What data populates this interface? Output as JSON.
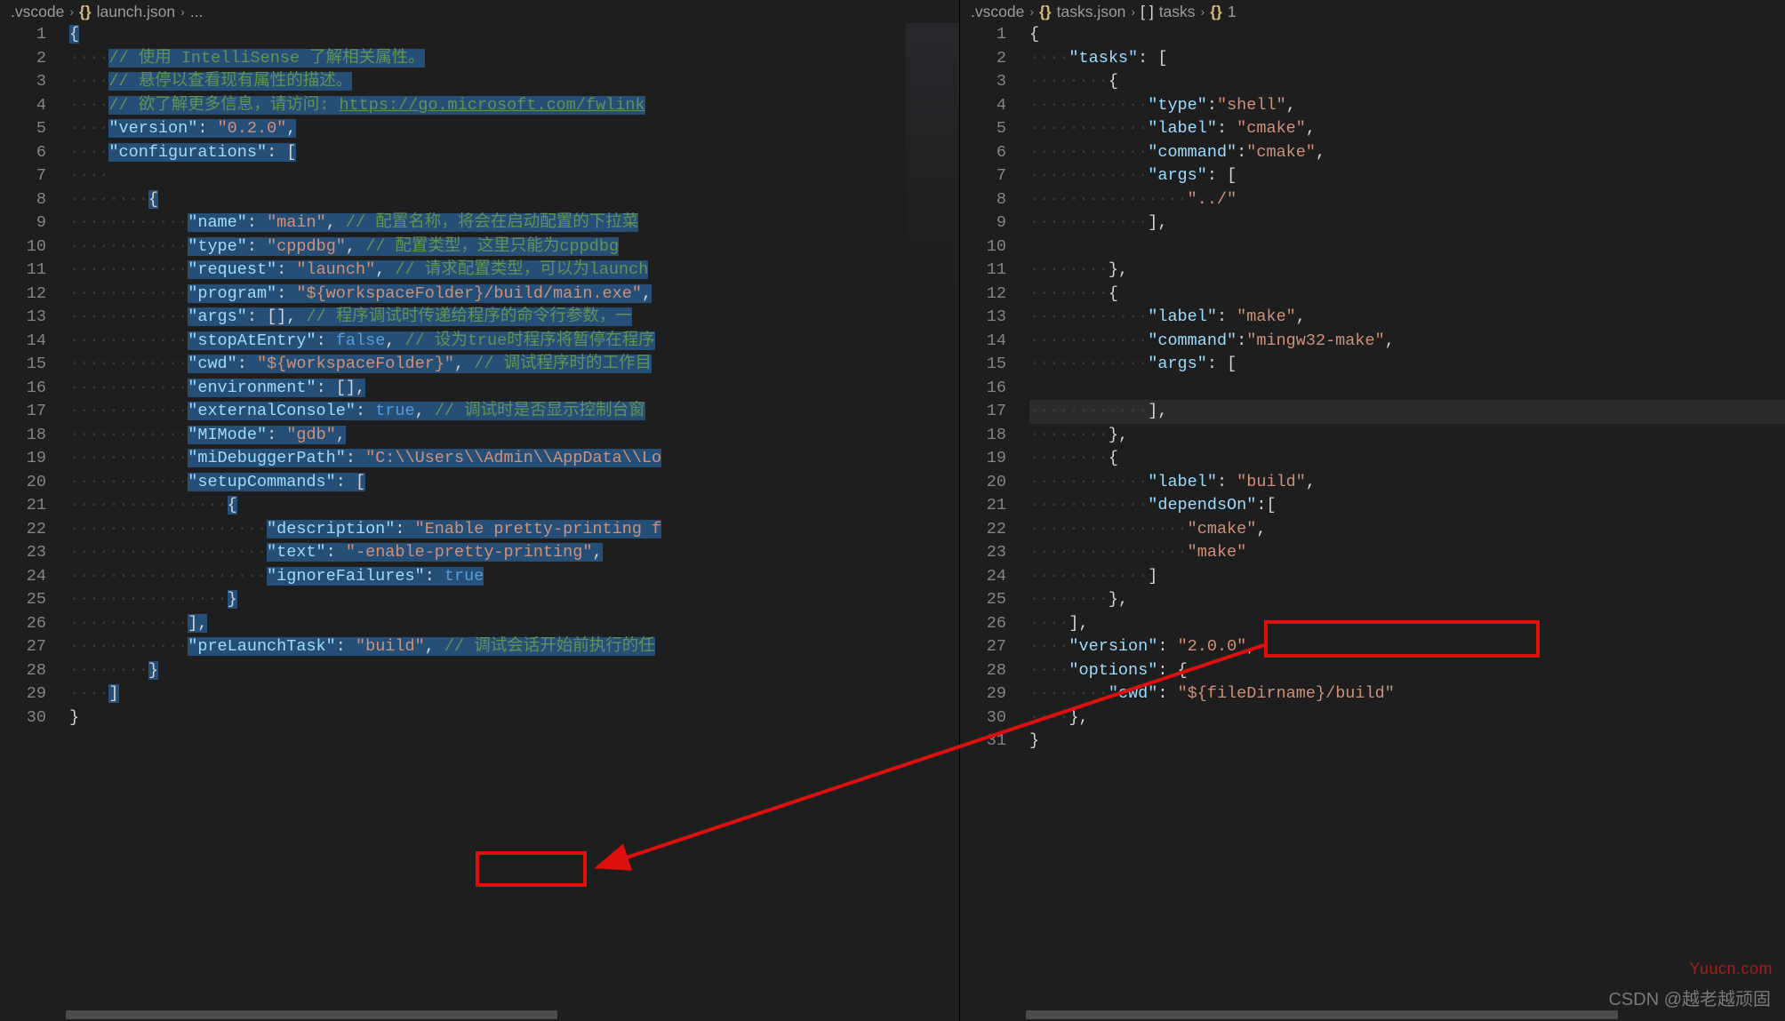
{
  "left": {
    "breadcrumb": {
      "folder": ".vscode",
      "file": "launch.json",
      "more": "..."
    },
    "lines": [
      {
        "n": 1,
        "indent": 0,
        "t": [
          [
            "b",
            "{"
          ]
        ]
      },
      {
        "n": 2,
        "indent": 1,
        "t": [
          [
            "c",
            "// 使用 IntelliSense 了解相关属性。"
          ]
        ]
      },
      {
        "n": 3,
        "indent": 1,
        "t": [
          [
            "c",
            "// 悬停以查看现有属性的描述。"
          ]
        ]
      },
      {
        "n": 4,
        "indent": 1,
        "t": [
          [
            "c",
            "// 欲了解更多信息，请访问: "
          ],
          [
            "link",
            "https://go.microsoft.com/fwlink"
          ]
        ]
      },
      {
        "n": 5,
        "indent": 1,
        "t": [
          [
            "k",
            "\"version\""
          ],
          [
            "p",
            ": "
          ],
          [
            "s",
            "\"0.2.0\""
          ],
          [
            "p",
            ","
          ]
        ]
      },
      {
        "n": 6,
        "indent": 1,
        "t": [
          [
            "k",
            "\"configurations\""
          ],
          [
            "p",
            ": "
          ],
          [
            "b",
            "["
          ]
        ]
      },
      {
        "n": 7,
        "indent": 1,
        "t": []
      },
      {
        "n": 8,
        "indent": 2,
        "t": [
          [
            "b",
            "{"
          ]
        ]
      },
      {
        "n": 9,
        "indent": 3,
        "t": [
          [
            "k",
            "\"name\""
          ],
          [
            "p",
            ": "
          ],
          [
            "s",
            "\"main\""
          ],
          [
            "p",
            ","
          ],
          [
            "c",
            " // 配置名称，将会在启动配置的下拉菜"
          ]
        ]
      },
      {
        "n": 10,
        "indent": 3,
        "t": [
          [
            "k",
            "\"type\""
          ],
          [
            "p",
            ": "
          ],
          [
            "s",
            "\"cppdbg\""
          ],
          [
            "p",
            ", "
          ],
          [
            "c",
            "// 配置类型，这里只能为cppdbg"
          ]
        ]
      },
      {
        "n": 11,
        "indent": 3,
        "t": [
          [
            "k",
            "\"request\""
          ],
          [
            "p",
            ": "
          ],
          [
            "s",
            "\"launch\""
          ],
          [
            "p",
            ", "
          ],
          [
            "c",
            "// 请求配置类型，可以为launch"
          ]
        ]
      },
      {
        "n": 12,
        "indent": 3,
        "t": [
          [
            "k",
            "\"program\""
          ],
          [
            "p",
            ": "
          ],
          [
            "s",
            "\"${workspaceFolder}/build/main.exe\""
          ],
          [
            "p",
            ","
          ]
        ]
      },
      {
        "n": 13,
        "indent": 3,
        "t": [
          [
            "k",
            "\"args\""
          ],
          [
            "p",
            ": "
          ],
          [
            "b",
            "[]"
          ],
          [
            "p",
            ", "
          ],
          [
            "c",
            "// 程序调试时传递给程序的命令行参数，一"
          ]
        ]
      },
      {
        "n": 14,
        "indent": 3,
        "t": [
          [
            "k",
            "\"stopAtEntry\""
          ],
          [
            "p",
            ": "
          ],
          [
            "bool",
            "false"
          ],
          [
            "p",
            ", "
          ],
          [
            "c",
            "// 设为true时程序将暂停在程序"
          ]
        ]
      },
      {
        "n": 15,
        "indent": 3,
        "t": [
          [
            "k",
            "\"cwd\""
          ],
          [
            "p",
            ": "
          ],
          [
            "s",
            "\"${workspaceFolder}\""
          ],
          [
            "p",
            ", "
          ],
          [
            "c",
            "// 调试程序时的工作目"
          ]
        ]
      },
      {
        "n": 16,
        "indent": 3,
        "t": [
          [
            "k",
            "\"environment\""
          ],
          [
            "p",
            ": "
          ],
          [
            "b",
            "[]"
          ],
          [
            "p",
            ","
          ]
        ]
      },
      {
        "n": 17,
        "indent": 3,
        "t": [
          [
            "k",
            "\"externalConsole\""
          ],
          [
            "p",
            ": "
          ],
          [
            "bool",
            "true"
          ],
          [
            "p",
            ", "
          ],
          [
            "c",
            "// 调试时是否显示控制台窗"
          ]
        ]
      },
      {
        "n": 18,
        "indent": 3,
        "t": [
          [
            "k",
            "\"MIMode\""
          ],
          [
            "p",
            ": "
          ],
          [
            "s",
            "\"gdb\""
          ],
          [
            "p",
            ","
          ]
        ]
      },
      {
        "n": 19,
        "indent": 3,
        "t": [
          [
            "k",
            "\"miDebuggerPath\""
          ],
          [
            "p",
            ": "
          ],
          [
            "s",
            "\"C:\\\\Users\\\\Admin\\\\AppData\\\\Lo"
          ]
        ]
      },
      {
        "n": 20,
        "indent": 3,
        "t": [
          [
            "k",
            "\"setupCommands\""
          ],
          [
            "p",
            ": "
          ],
          [
            "b",
            "["
          ]
        ]
      },
      {
        "n": 21,
        "indent": 4,
        "t": [
          [
            "b",
            "{"
          ]
        ]
      },
      {
        "n": 22,
        "indent": 5,
        "t": [
          [
            "k",
            "\"description\""
          ],
          [
            "p",
            ": "
          ],
          [
            "s",
            "\"Enable pretty-printing f"
          ]
        ]
      },
      {
        "n": 23,
        "indent": 5,
        "t": [
          [
            "k",
            "\"text\""
          ],
          [
            "p",
            ": "
          ],
          [
            "s",
            "\"-enable-pretty-printing\""
          ],
          [
            "p",
            ","
          ]
        ]
      },
      {
        "n": 24,
        "indent": 5,
        "t": [
          [
            "k",
            "\"ignoreFailures\""
          ],
          [
            "p",
            ": "
          ],
          [
            "bool",
            "true"
          ]
        ]
      },
      {
        "n": 25,
        "indent": 4,
        "t": [
          [
            "b",
            "}"
          ]
        ]
      },
      {
        "n": 26,
        "indent": 3,
        "t": [
          [
            "b",
            "]"
          ],
          [
            "p",
            ","
          ]
        ]
      },
      {
        "n": 27,
        "indent": 3,
        "t": [
          [
            "k",
            "\"preLaunchTask\""
          ],
          [
            "p",
            ": "
          ],
          [
            "s",
            "\"build\""
          ],
          [
            "p",
            ", "
          ],
          [
            "c",
            "// 调试会话开始前执行的任"
          ]
        ]
      },
      {
        "n": 28,
        "indent": 2,
        "t": [
          [
            "b",
            "}"
          ]
        ]
      },
      {
        "n": 29,
        "indent": 1,
        "t": [
          [
            "b",
            "]"
          ]
        ]
      },
      {
        "n": 30,
        "indent": 0,
        "t": [
          [
            "b",
            "}"
          ]
        ]
      }
    ]
  },
  "right": {
    "breadcrumb": {
      "folder": ".vscode",
      "file": "tasks.json",
      "array": "tasks",
      "obj": "1"
    },
    "lines": [
      {
        "n": 1,
        "indent": 0,
        "t": [
          [
            "b",
            "{"
          ]
        ]
      },
      {
        "n": 2,
        "indent": 1,
        "t": [
          [
            "k",
            "\"tasks\""
          ],
          [
            "p",
            ": "
          ],
          [
            "b",
            "["
          ]
        ]
      },
      {
        "n": 3,
        "indent": 2,
        "t": [
          [
            "b",
            "{"
          ]
        ]
      },
      {
        "n": 4,
        "indent": 3,
        "t": [
          [
            "k",
            "\"type\""
          ],
          [
            "p",
            ":"
          ],
          [
            "s",
            "\"shell\""
          ],
          [
            "p",
            ","
          ]
        ]
      },
      {
        "n": 5,
        "indent": 3,
        "t": [
          [
            "k",
            "\"label\""
          ],
          [
            "p",
            ": "
          ],
          [
            "s",
            "\"cmake\""
          ],
          [
            "p",
            ","
          ]
        ]
      },
      {
        "n": 6,
        "indent": 3,
        "t": [
          [
            "k",
            "\"command\""
          ],
          [
            "p",
            ":"
          ],
          [
            "s",
            "\"cmake\""
          ],
          [
            "p",
            ","
          ]
        ]
      },
      {
        "n": 7,
        "indent": 3,
        "t": [
          [
            "k",
            "\"args\""
          ],
          [
            "p",
            ": "
          ],
          [
            "b",
            "["
          ]
        ]
      },
      {
        "n": 8,
        "indent": 4,
        "t": [
          [
            "s",
            "\"../\""
          ]
        ]
      },
      {
        "n": 9,
        "indent": 3,
        "t": [
          [
            "b",
            "]"
          ],
          [
            "p",
            ","
          ]
        ]
      },
      {
        "n": 10,
        "indent": 0,
        "t": []
      },
      {
        "n": 11,
        "indent": 2,
        "t": [
          [
            "b",
            "}"
          ],
          [
            "p",
            ","
          ]
        ]
      },
      {
        "n": 12,
        "indent": 2,
        "t": [
          [
            "b",
            "{"
          ]
        ]
      },
      {
        "n": 13,
        "indent": 3,
        "t": [
          [
            "k",
            "\"label\""
          ],
          [
            "p",
            ": "
          ],
          [
            "s",
            "\"make\""
          ],
          [
            "p",
            ","
          ]
        ]
      },
      {
        "n": 14,
        "indent": 3,
        "t": [
          [
            "k",
            "\"command\""
          ],
          [
            "p",
            ":"
          ],
          [
            "s",
            "\"mingw32-make\""
          ],
          [
            "p",
            ","
          ]
        ]
      },
      {
        "n": 15,
        "indent": 3,
        "t": [
          [
            "k",
            "\"args\""
          ],
          [
            "p",
            ": "
          ],
          [
            "b",
            "["
          ]
        ]
      },
      {
        "n": 16,
        "indent": 0,
        "t": []
      },
      {
        "n": 17,
        "indent": 3,
        "t": [
          [
            "b",
            "]"
          ],
          [
            "p",
            ","
          ]
        ]
      },
      {
        "n": 18,
        "indent": 2,
        "t": [
          [
            "b",
            "}"
          ],
          [
            "p",
            ","
          ]
        ]
      },
      {
        "n": 19,
        "indent": 2,
        "t": [
          [
            "b",
            "{"
          ]
        ]
      },
      {
        "n": 20,
        "indent": 3,
        "t": [
          [
            "k",
            "\"label\""
          ],
          [
            "p",
            ": "
          ],
          [
            "s",
            "\"build\""
          ],
          [
            "p",
            ","
          ]
        ]
      },
      {
        "n": 21,
        "indent": 3,
        "t": [
          [
            "k",
            "\"dependsOn\""
          ],
          [
            "p",
            ":"
          ],
          [
            "b",
            "["
          ]
        ]
      },
      {
        "n": 22,
        "indent": 4,
        "t": [
          [
            "s",
            "\"cmake\""
          ],
          [
            "p",
            ","
          ]
        ]
      },
      {
        "n": 23,
        "indent": 4,
        "t": [
          [
            "s",
            "\"make\""
          ]
        ]
      },
      {
        "n": 24,
        "indent": 3,
        "t": [
          [
            "b",
            "]"
          ]
        ]
      },
      {
        "n": 25,
        "indent": 2,
        "t": [
          [
            "b",
            "}"
          ],
          [
            "p",
            ","
          ]
        ]
      },
      {
        "n": 26,
        "indent": 1,
        "t": [
          [
            "b",
            "]"
          ],
          [
            "p",
            ","
          ]
        ]
      },
      {
        "n": 27,
        "indent": 1,
        "t": [
          [
            "k",
            "\"version\""
          ],
          [
            "p",
            ": "
          ],
          [
            "s",
            "\"2.0.0\""
          ],
          [
            "p",
            ","
          ]
        ]
      },
      {
        "n": 28,
        "indent": 1,
        "t": [
          [
            "k",
            "\"options\""
          ],
          [
            "p",
            ": "
          ],
          [
            "b",
            "{"
          ]
        ]
      },
      {
        "n": 29,
        "indent": 2,
        "t": [
          [
            "k",
            "\"cwd\""
          ],
          [
            "p",
            ": "
          ],
          [
            "s",
            "\"${fileDirname}/build\""
          ]
        ]
      },
      {
        "n": 30,
        "indent": 1,
        "t": [
          [
            "b",
            "}"
          ],
          [
            "p",
            ","
          ]
        ]
      },
      {
        "n": 31,
        "indent": 0,
        "t": [
          [
            "b",
            "}"
          ]
        ]
      }
    ],
    "highlightLine": 17
  },
  "watermark1": "Yuucn.com",
  "watermark2": "CSDN @越老越顽固"
}
